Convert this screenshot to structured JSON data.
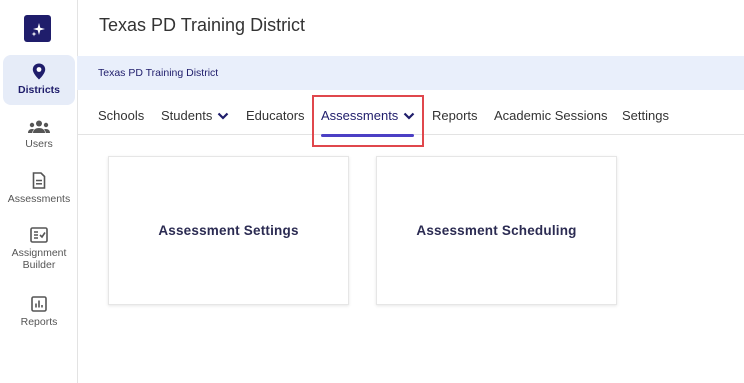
{
  "header": {
    "title": "Texas PD Training District"
  },
  "breadcrumb": {
    "text": "Texas PD Training District"
  },
  "sidebar": {
    "items": [
      {
        "label": "Districts",
        "icon": "location-pin-icon",
        "active": true
      },
      {
        "label": "Users",
        "icon": "users-icon"
      },
      {
        "label": "Assessments",
        "icon": "document-icon"
      },
      {
        "label": "Assignment Builder",
        "icon": "assignment-builder-icon"
      },
      {
        "label": "Reports",
        "icon": "bar-chart-icon"
      }
    ]
  },
  "tabs": [
    {
      "label": "Schools"
    },
    {
      "label": "Students",
      "dropdown": true
    },
    {
      "label": "Educators"
    },
    {
      "label": "Assessments",
      "dropdown": true,
      "active": true
    },
    {
      "label": "Reports"
    },
    {
      "label": "Academic Sessions"
    },
    {
      "label": "Settings"
    }
  ],
  "cards": [
    {
      "label": "Assessment Settings"
    },
    {
      "label": "Assessment Scheduling"
    }
  ],
  "colors": {
    "brand": "#1f1d6b",
    "accent": "#4b3fc4",
    "highlight": "#e0474c",
    "breadcrumb_bg": "#e9effb"
  }
}
